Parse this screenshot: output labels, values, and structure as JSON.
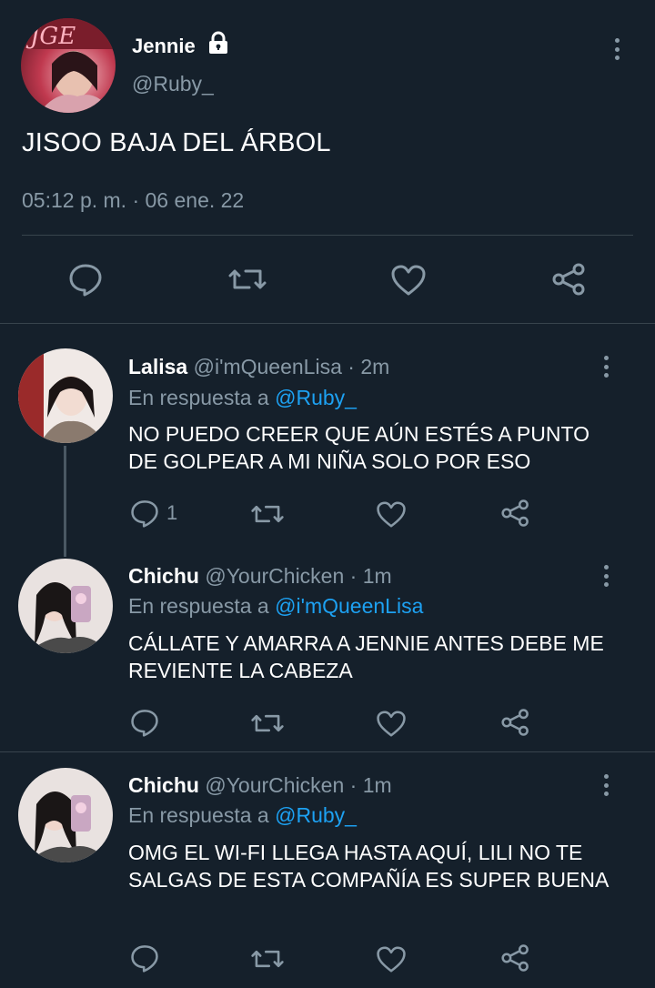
{
  "main_tweet": {
    "display_name": "Jennie",
    "handle": "@Ruby_",
    "text": "JISOO BAJA DEL ÁRBOL",
    "timestamp": "05:12 p. m. · 06 ene. 22",
    "locked_icon": "lock-icon",
    "avatar_text": "JGE"
  },
  "replies": [
    {
      "display_name": "Lalisa",
      "handle": "@i'mQueenLisa",
      "time": "· 2m",
      "replying_label": "En respuesta a",
      "replying_to": "@Ruby_",
      "text": "NO PUEDO CREER QUE AÚN ESTÉS A PUNTO DE GOLPEAR A MI NIÑA SOLO POR ESO",
      "reply_count": "1"
    },
    {
      "display_name": "Chichu",
      "handle": "@YourChicken",
      "time": "· 1m",
      "replying_label": "En respuesta a",
      "replying_to": "@i'mQueenLisa",
      "text": "CÁLLATE Y AMARRA A JENNIE ANTES DEBE ME REVIENTE LA CABEZA",
      "reply_count": ""
    },
    {
      "display_name": "Chichu",
      "handle": "@YourChicken",
      "time": "· 1m",
      "replying_label": "En respuesta a",
      "replying_to": "@Ruby_",
      "text": "OMG EL WI-FI LLEGA HASTA AQUÍ, LILI NO TE SALGAS DE ESTA COMPAÑÍA ES SUPER BUENA",
      "reply_count": ""
    }
  ],
  "icons": {
    "reply": "comment-icon",
    "retweet": "retweet-icon",
    "like": "heart-icon",
    "share": "share-icon",
    "more": "more-vertical-icon"
  },
  "colors": {
    "background": "#15202b",
    "separator": "#38444d",
    "muted": "#8899a6",
    "link": "#1da1f2"
  }
}
